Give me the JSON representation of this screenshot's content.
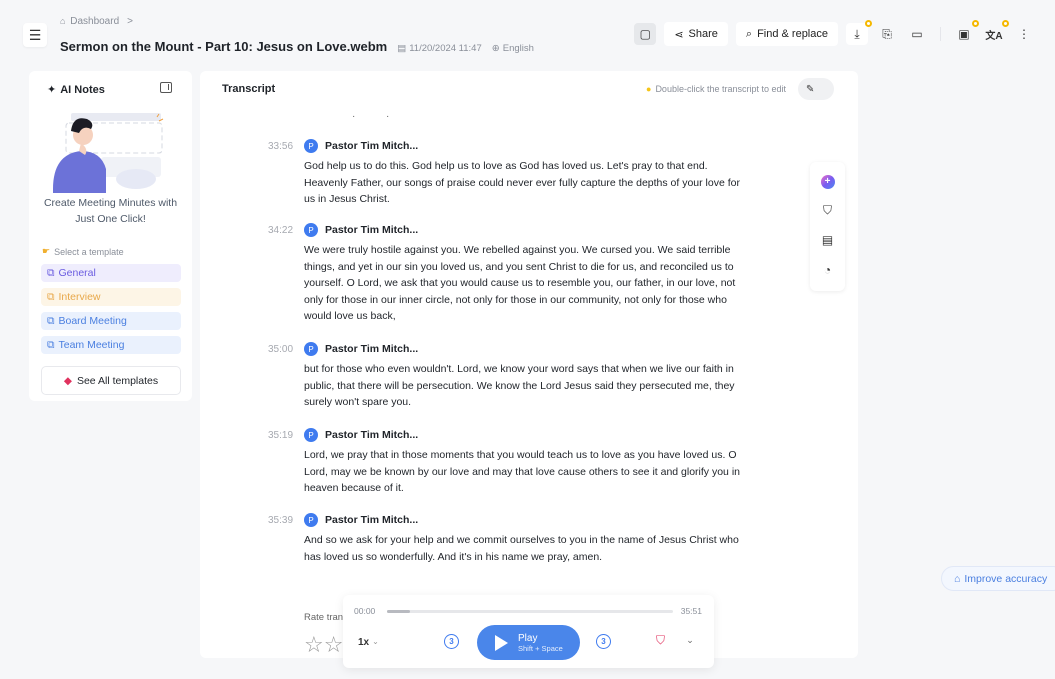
{
  "header": {
    "breadcrumb": "Dashboard",
    "breadcrumb_separator": ">",
    "file_title": "Sermon on the Mount - Part 10: Jesus on Love.webm",
    "date": "11/20/2024 11:47",
    "language": "English"
  },
  "toolbar": {
    "share_label": "Share",
    "find_replace_label": "Find & replace",
    "icons": [
      "layout-toggle-icon",
      "download-icon",
      "export-icon",
      "folder-icon",
      "save-icon",
      "translate-icon",
      "more-icon"
    ]
  },
  "ai_notes": {
    "title": "AI Notes",
    "promo_line1": "Create Meeting Minutes with",
    "promo_line2": "Just One Click!",
    "select_label": "Select a template",
    "templates": [
      {
        "label": "General",
        "color": "#6a5ce0"
      },
      {
        "label": "Interview",
        "color": "#e8a84a"
      },
      {
        "label": "Board Meeting",
        "color": "#4a7fe0"
      },
      {
        "label": "Team Meeting",
        "color": "#4a7fe0"
      }
    ],
    "see_all_label": "See All templates"
  },
  "transcript": {
    "title": "Transcript",
    "hint": "Double-click the transcript to edit",
    "segments": [
      {
        "time": "33:56",
        "avatar": "P",
        "speaker": "Pastor Tim Mitch...",
        "text": "God help us to do this. God help us to love as God has loved us. Let's pray to that end. Heavenly Father, our songs of praise could never ever fully capture the depths of your love for us in Jesus Christ."
      },
      {
        "time": "34:22",
        "avatar": "P",
        "speaker": "Pastor Tim Mitch...",
        "text": "We were truly hostile against you. We rebelled against you. We cursed you. We said terrible things, and yet in our sin you loved us, and you sent Christ to die for us, and reconciled us to yourself. O Lord, we ask that you would cause us to resemble you, our father, in our love, not only for those in our inner circle, not only for those in our community, not only for those who would love us back,"
      },
      {
        "time": "35:00",
        "avatar": "P",
        "speaker": "Pastor Tim Mitch...",
        "text": "but for those who even wouldn't. Lord, we know your word says that when we live our faith in public, that there will be persecution. We know the Lord Jesus said they persecuted me, they surely won't spare you."
      },
      {
        "time": "35:19",
        "avatar": "P",
        "speaker": "Pastor Tim Mitch...",
        "text": "Lord, we pray that in those moments that you would teach us to love as you have loved us. O Lord, may we be known by our love and may that love cause others to see it and glorify you in heaven because of it."
      },
      {
        "time": "35:39",
        "avatar": "P",
        "speaker": "Pastor Tim Mitch...",
        "text": "And so we ask for your help and we commit ourselves to you in the name of Jesus Christ who has loved us so wonderfully. And it's in his name we pray, amen."
      }
    ],
    "rate_label": "Rate tran",
    "stars": "☆☆"
  },
  "side_tools": [
    "ai-assistant-icon",
    "bookmark-add-icon",
    "comment-icon",
    "pie-chart-icon"
  ],
  "improve_label": "Improve accuracy",
  "player": {
    "current_time": "00:00",
    "duration": "35:51",
    "buffered_fraction": 0.08,
    "speed": "1x",
    "skip_back": "3",
    "skip_forward": "3",
    "play_label": "Play",
    "play_shortcut": "Shift + Space"
  },
  "colors": {
    "accent": "#4a86ea",
    "badge": "#f5b800",
    "mark": "#e0325e"
  }
}
